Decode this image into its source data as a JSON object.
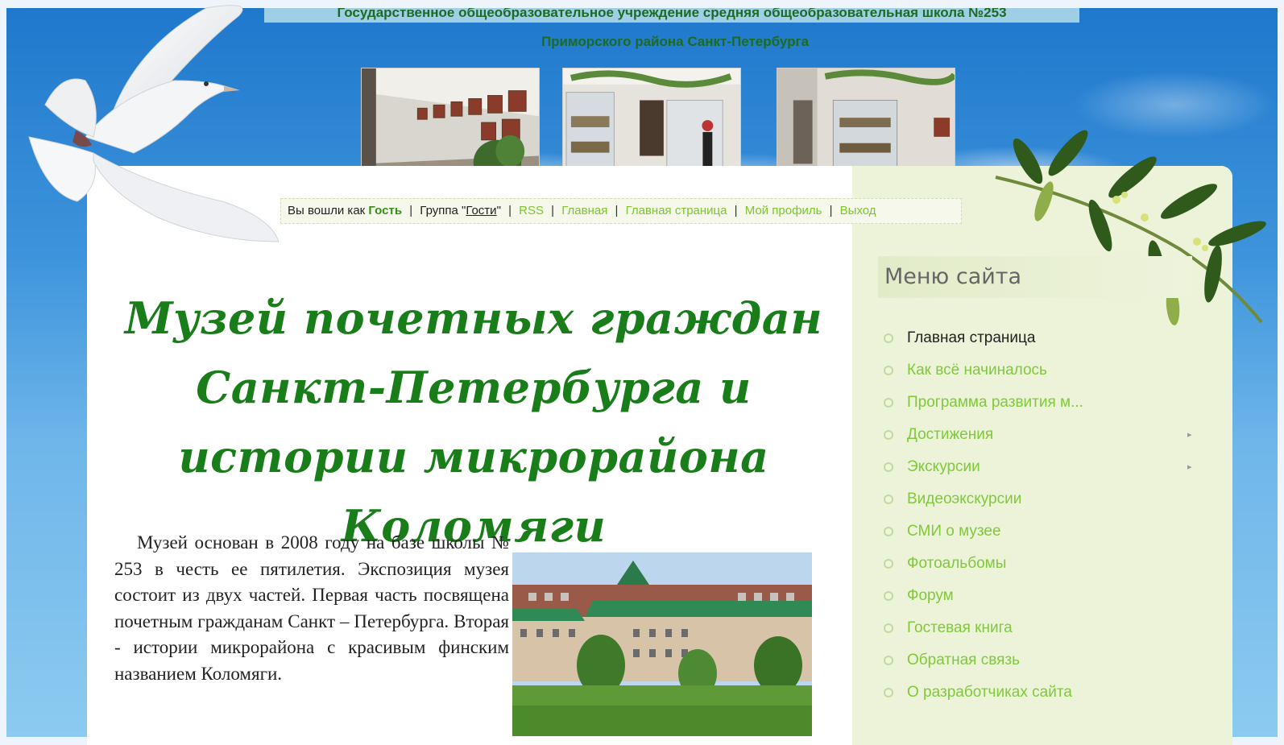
{
  "header": {
    "school_line1": "Государственное общеобразовательное учреждение средняя общеобразовательная школа №253",
    "school_line2": "Приморского района Санкт-Петербурга"
  },
  "userbar": {
    "logged_prefix": "Вы вошли как",
    "user_name": "Гость",
    "group_prefix": "Группа \"",
    "group_name": "Гости",
    "group_suffix": "\"",
    "links": [
      "RSS",
      "Главная",
      "Главная страница",
      "Мой профиль",
      "Выход"
    ]
  },
  "main": {
    "title": "Музей почетных граждан Санкт-Петербурга и истории микрорайона Коломяги",
    "body": "Музей основан в 2008 году на базе школы № 253 в честь ее пятилетия. Экспозиция музея состоит из двух частей. Первая часть посвящена почетным гражданам Санкт – Петербурга. Вторая - истории микрорайона с красивым финским названием Коломяги."
  },
  "sidebar": {
    "title": "Меню сайта",
    "items": [
      {
        "label": "Главная страница",
        "active": true,
        "submenu": false
      },
      {
        "label": "Как всё начиналось",
        "active": false,
        "submenu": false
      },
      {
        "label": "Программа развития м...",
        "active": false,
        "submenu": false
      },
      {
        "label": "Достижения",
        "active": false,
        "submenu": true
      },
      {
        "label": "Экскурсии",
        "active": false,
        "submenu": true
      },
      {
        "label": "Видеоэкскурсии",
        "active": false,
        "submenu": false
      },
      {
        "label": "СМИ о музее",
        "active": false,
        "submenu": false
      },
      {
        "label": "Фотоальбомы",
        "active": false,
        "submenu": false
      },
      {
        "label": "Форум",
        "active": false,
        "submenu": false
      },
      {
        "label": "Гостевая книга",
        "active": false,
        "submenu": false
      },
      {
        "label": "Обратная связь",
        "active": false,
        "submenu": false
      },
      {
        "label": "О разработчиках сайта",
        "active": false,
        "submenu": false
      }
    ]
  },
  "colors": {
    "title_green": "#197d1a",
    "link_green": "#7cc52e",
    "sky_blue": "#3f95dc"
  }
}
